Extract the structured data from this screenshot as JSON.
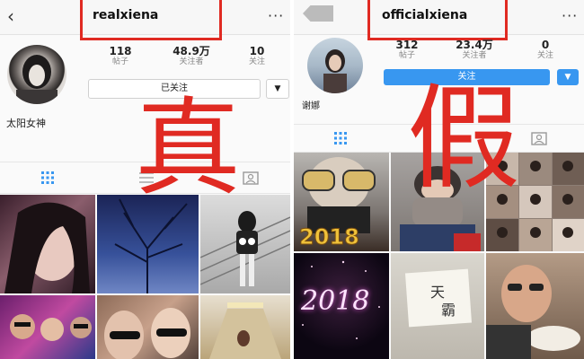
{
  "left": {
    "username": "realxiena",
    "more_label": "···",
    "back_label": "‹",
    "stats": [
      {
        "value": "118",
        "label": "帖子"
      },
      {
        "value": "48.9万",
        "label": "关注者"
      },
      {
        "value": "10",
        "label": "关注"
      }
    ],
    "follow_button": "已关注",
    "dropdown": "▼",
    "display_name": "太阳女神",
    "overlay_char": "真"
  },
  "right": {
    "username": "officialxiena",
    "more_label": "···",
    "stats": [
      {
        "value": "312",
        "label": "帖子"
      },
      {
        "value": "23.4万",
        "label": "关注者"
      },
      {
        "value": "0",
        "label": "关注"
      }
    ],
    "follow_button": "关注",
    "dropdown": "▼",
    "display_name": "谢娜",
    "overlay_char": "假",
    "photo_texts": {
      "year1": "2018",
      "year2": "2018",
      "note1": "天",
      "note2": "霸"
    }
  },
  "colors": {
    "accent_blue": "#3897f0",
    "annotation_red": "#e02a22"
  }
}
